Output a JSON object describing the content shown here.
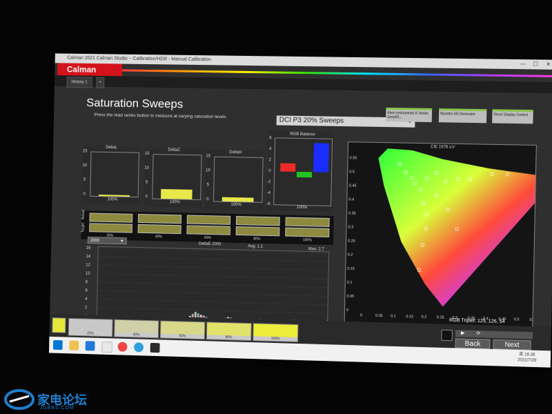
{
  "window": {
    "title": "Calman 2021 Calman Studio  ~ Calibration/HDR - Manual Calibration",
    "controls": [
      "—",
      "☐",
      "✕"
    ]
  },
  "app": {
    "logo_text": "Calman"
  },
  "tabs": [
    {
      "label": "History 1"
    },
    {
      "label": "+"
    }
  ],
  "page": {
    "title": "Saturation Sweeps",
    "instructions": "Press the read series button to measure at varying saturation levels",
    "series_select": "DCI P3 20% Sweeps"
  },
  "devices": [
    {
      "label": "Klein Instruments K Series",
      "sub": "Sony65..."
    },
    {
      "label": "Murideo 6G Generator",
      "sub": ""
    },
    {
      "label": "Direct Display Control",
      "sub": ""
    }
  ],
  "small_charts": {
    "deltaL": {
      "title": "DeltaL",
      "yticks": [
        "15",
        "10",
        "5",
        "0"
      ],
      "xlabel": "100%",
      "value_frac": 0.0,
      "color": "#e8e84a"
    },
    "deltaC": {
      "title": "DeltaC",
      "yticks": [
        "15",
        "10",
        "5",
        "0"
      ],
      "xlabel": "100%",
      "value_frac": 0.22,
      "color": "#e8e84a"
    },
    "deltaH": {
      "title": "DeltaH",
      "yticks": [
        "15",
        "10",
        "5",
        "0"
      ],
      "xlabel": "100%",
      "value_frac": 0.1,
      "color": "#e8e84a"
    }
  },
  "rgb_balance": {
    "title": "RGB Balance",
    "yticks": [
      "6",
      "4",
      "2",
      "0",
      "-2",
      "-4",
      "-6"
    ],
    "xlabel": "100%",
    "bars": [
      {
        "color": "#ee2a2a",
        "value": 1.5
      },
      {
        "color": "#22c422",
        "value": -1.0
      },
      {
        "color": "#1a2cff",
        "value": 5.2
      }
    ]
  },
  "swatches": {
    "row_labels": [
      "Actual",
      "Target"
    ],
    "columns": [
      "20%",
      "40%",
      "60%",
      "80%",
      "100%"
    ]
  },
  "deltaE": {
    "select": "2000",
    "title": "DeltaE 2000",
    "avg": "Avg: 1.1",
    "max": "Max: 2.7",
    "yticks": [
      "16",
      "14",
      "12",
      "10",
      "8",
      "6",
      "4",
      "2",
      "0"
    ],
    "xticks": [
      "0",
      "100",
      "20%",
      "40%",
      "60%",
      "80%",
      "100%"
    ]
  },
  "cie": {
    "title": "CIE 1976 u'v'",
    "yticks": [
      "0.55",
      "0.5",
      "0.45",
      "0.4",
      "0.35",
      "0.3",
      "0.25",
      "0.2",
      "0.15",
      "0.1",
      "0.05",
      "0"
    ],
    "xticks": [
      "0",
      "0.05",
      "0.1",
      "0.15",
      "0.2",
      "0.25",
      "0.3",
      "0.35",
      "0.4",
      "0.45",
      "0.5",
      "0.55"
    ],
    "rgb_triplet": "RGB Triplet: 125, 126, 54"
  },
  "steps": [
    {
      "label": "20%",
      "color": "#c8c8c8"
    },
    {
      "label": "40%",
      "color": "#cfcfa8"
    },
    {
      "label": "60%",
      "color": "#d8d88a"
    },
    {
      "label": "80%",
      "color": "#e2e26a"
    },
    {
      "label": "100%",
      "color": "#ecec3a"
    }
  ],
  "nav": {
    "back": "Back",
    "next": "Next"
  },
  "taskbar": {
    "time": "16:26",
    "date": "2021/7/29",
    "lang": "英"
  },
  "watermark": {
    "text": "家电论坛",
    "url": "JDBBS.COM"
  }
}
